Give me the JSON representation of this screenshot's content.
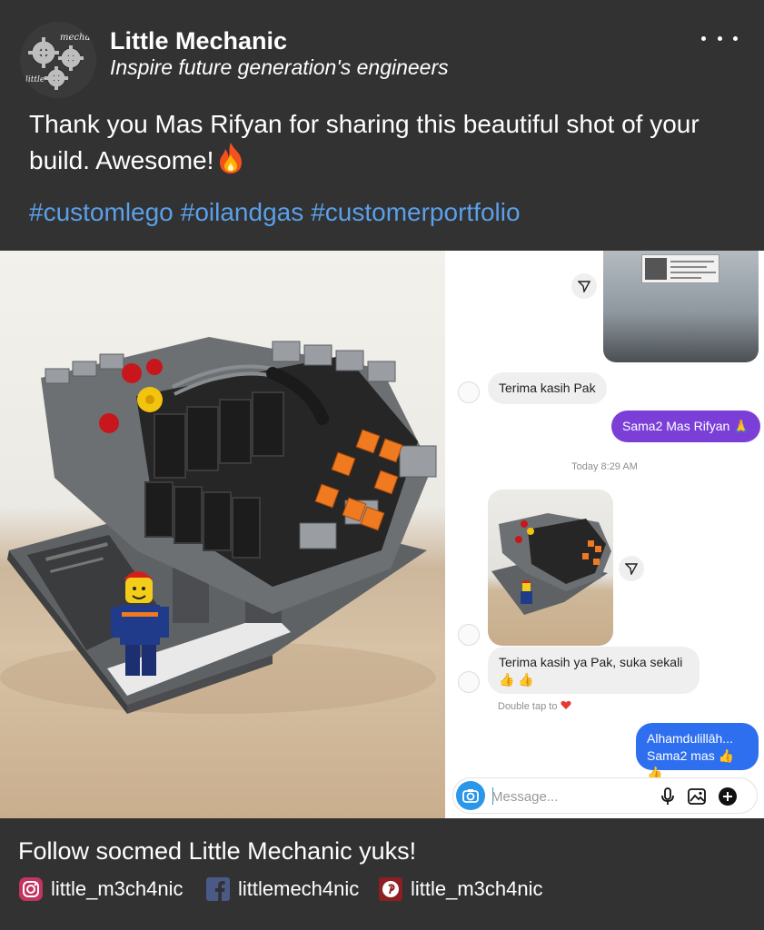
{
  "header": {
    "name": "Little Mechanic",
    "tagline": "Inspire future generation's engineers",
    "logo_text_top": "mechanic",
    "logo_text_bottom": "little",
    "more_icon": "more-horizontal-icon"
  },
  "post": {
    "caption": "Thank you Mas Rifyan for sharing this beautiful shot of your build. Awesome!",
    "caption_emoji": "fire-emoji",
    "hashtags": [
      "#customlego",
      "#oilandgas",
      "#customerportfolio"
    ]
  },
  "chat": {
    "messages": [
      {
        "from": "them",
        "text": "Terima kasih Pak"
      },
      {
        "from": "me",
        "text": "Sama2 Mas Rifyan 🙏"
      },
      {
        "from": "them",
        "text": "Terima kasih ya Pak, suka sekali"
      },
      {
        "from": "me",
        "text": "Alhamdulillāh..."
      },
      {
        "from": "me",
        "text": "Sama2 mas 👍👍"
      }
    ],
    "reaction_emojis": "👍 👍",
    "timestamp": "Today 8:29 AM",
    "double_tap_hint": "Double tap to",
    "composer_placeholder": "Message...",
    "icons": [
      "camera-icon",
      "microphone-icon",
      "gallery-icon",
      "add-icon",
      "send-icon"
    ]
  },
  "footer": {
    "follow_text": "Follow socmed Little Mechanic yuks!",
    "socials": [
      {
        "platform": "instagram",
        "handle": "little_m3ch4nic"
      },
      {
        "platform": "facebook",
        "handle": "littlemech4nic"
      },
      {
        "platform": "pinterest",
        "handle": "little_m3ch4nic"
      }
    ]
  },
  "colors": {
    "background": "#323232",
    "hashtag": "#5aa0ea",
    "bubble_out": "#7b3fd8",
    "bubble_out_blue": "#2e6ff0",
    "accent_orange": "#f07a1f",
    "camera_blue": "#2a97e8"
  }
}
